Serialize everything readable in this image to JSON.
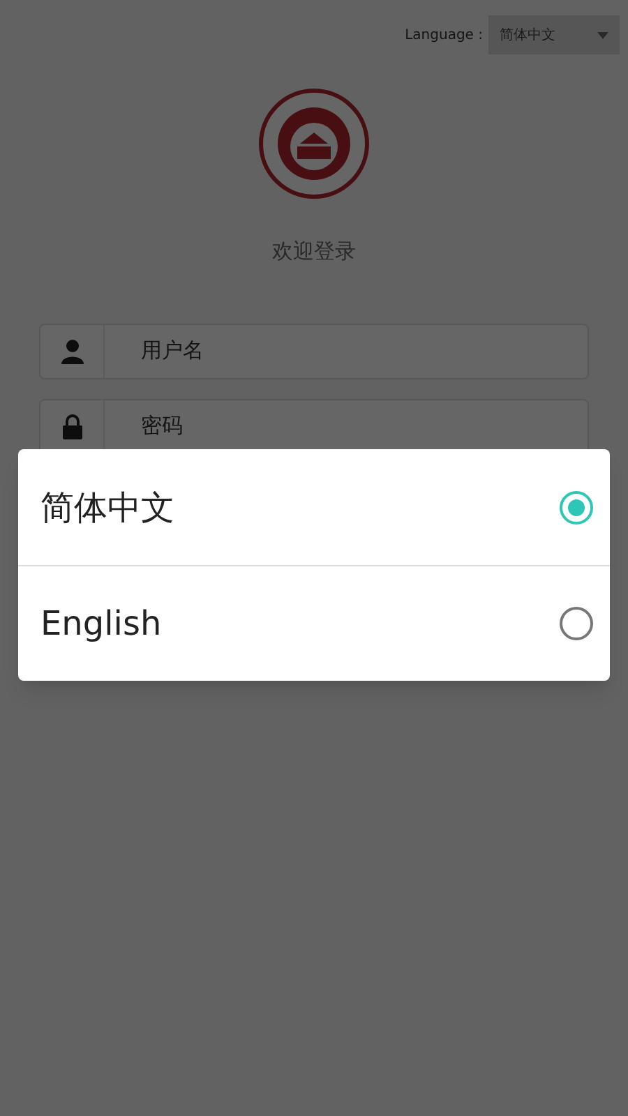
{
  "language_selector": {
    "label": "Language :",
    "value": "简体中文"
  },
  "welcome_title": "欢迎登录",
  "login_form": {
    "username": {
      "placeholder": "用户名"
    },
    "password": {
      "placeholder": "密码"
    }
  },
  "language_dialog": {
    "options": [
      {
        "label": "简体中文",
        "selected": true
      },
      {
        "label": "English",
        "selected": false
      }
    ]
  }
}
